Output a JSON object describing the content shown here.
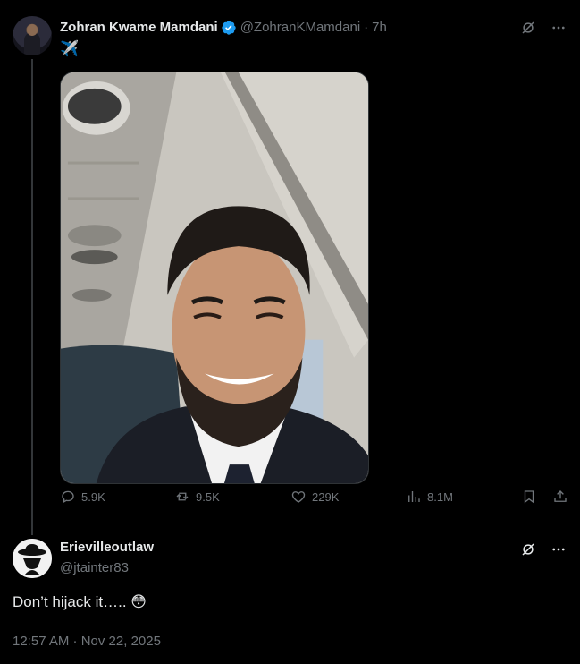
{
  "tweet": {
    "author_name": "Zohran Kwame Mamdani",
    "handle": "@ZohranKMamdani",
    "separator": "·",
    "time": "7h",
    "text": "✈️",
    "stats": {
      "replies": "5.9K",
      "retweets": "9.5K",
      "likes": "229K",
      "views": "8.1M"
    }
  },
  "reply": {
    "author_name": "Erievilleoutlaw",
    "handle": "@jtainter83",
    "text": "Don’t hijack it….. 😳",
    "timestamp": "12:57 AM · Nov 22, 2025"
  },
  "colors": {
    "background": "#000000",
    "text": "#e7e9ea",
    "muted": "#71767b",
    "verified": "#1d9bf0",
    "border": "#2f3336"
  },
  "icons": [
    "grok-icon",
    "more-icon",
    "reply-icon",
    "retweet-icon",
    "like-icon",
    "views-icon",
    "bookmark-icon",
    "share-icon",
    "verified-badge-icon"
  ]
}
